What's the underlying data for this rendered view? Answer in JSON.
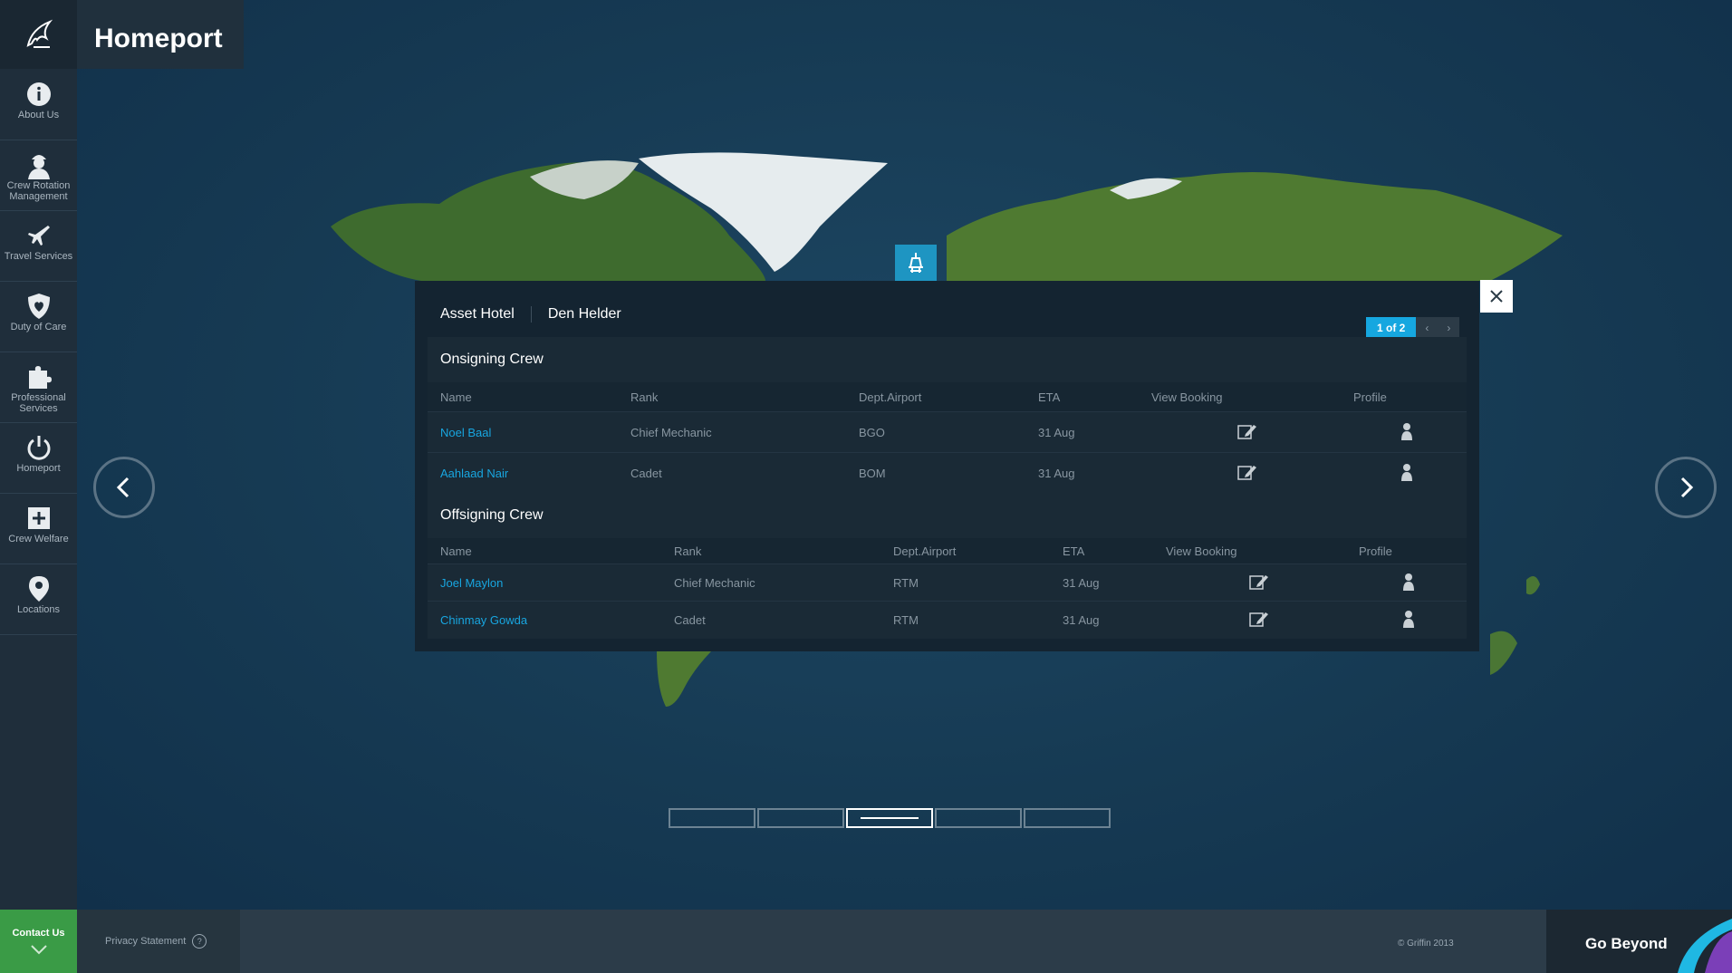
{
  "app": {
    "title": "Homeport"
  },
  "sidebar": {
    "items": [
      {
        "label": "About Us",
        "icon": "info-icon"
      },
      {
        "label": "Crew Rotation Management",
        "icon": "crew-icon"
      },
      {
        "label": "Travel Services",
        "icon": "plane-icon"
      },
      {
        "label": "Duty of Care",
        "icon": "shield-icon"
      },
      {
        "label": "Professional Services",
        "icon": "puzzle-icon"
      },
      {
        "label": "Homeport",
        "icon": "power-icon"
      },
      {
        "label": "Crew Welfare",
        "icon": "plus-icon"
      },
      {
        "label": "Locations",
        "icon": "pin-icon"
      }
    ],
    "contact_label": "Contact Us"
  },
  "footer": {
    "privacy_label": "Privacy Statement",
    "copyright": "© Griffin 2013",
    "tagline": "Go Beyond"
  },
  "modal": {
    "asset": "Asset Hotel",
    "location": "Den Helder",
    "paging": "1 of 2",
    "onsigning": {
      "title": "Onsigning Crew",
      "columns": [
        "Name",
        "Rank",
        "Dept.Airport",
        "ETA",
        "View Booking",
        "Profile"
      ],
      "rows": [
        {
          "name": "Noel Baal",
          "rank": "Chief Mechanic",
          "airport": "BGO",
          "eta": "31 Aug"
        },
        {
          "name": "Aahlaad Nair",
          "rank": "Cadet",
          "airport": "BOM",
          "eta": "31 Aug"
        }
      ]
    },
    "offsigning": {
      "title": "Offsigning Crew",
      "columns": [
        "Name",
        "Rank",
        "Dept.Airport",
        "ETA",
        "View Booking",
        "Profile"
      ],
      "rows": [
        {
          "name": "Joel Maylon",
          "rank": "Chief Mechanic",
          "airport": "RTM",
          "eta": "31 Aug"
        },
        {
          "name": "Chinmay Gowda",
          "rank": "Cadet",
          "airport": "RTM",
          "eta": "31 Aug"
        }
      ]
    }
  },
  "pager": {
    "count": 5,
    "active": 3
  },
  "colors": {
    "accent": "#16a7e0",
    "contact": "#3a9b46",
    "background": "#15334a"
  }
}
